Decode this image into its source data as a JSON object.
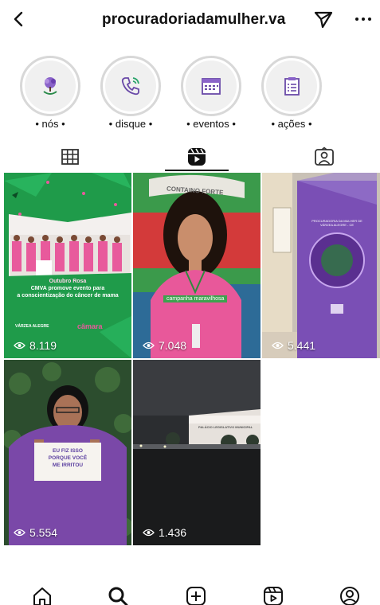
{
  "header": {
    "username": "procuradoriadamulher.va"
  },
  "highlights": [
    {
      "label": "• nós •",
      "icon": "tree-hands-icon"
    },
    {
      "label": "• disque •",
      "icon": "phone-icon"
    },
    {
      "label": "• eventos •",
      "icon": "calendar-icon"
    },
    {
      "label": "• ações •",
      "icon": "clipboard-icon"
    }
  ],
  "tabs": [
    {
      "name": "grid",
      "icon": "grid-icon"
    },
    {
      "name": "reels",
      "icon": "reels-icon",
      "active": true
    },
    {
      "name": "tagged",
      "icon": "tagged-person-icon"
    }
  ],
  "reels": [
    {
      "views": "8.119",
      "caption_title": "Outubro Rosa",
      "caption_line1": "CMVA promove evento para",
      "caption_line2": "a conscientização do câncer de mama",
      "logo_left": "VÁRZEA ALEGRE",
      "logo_right": "câmara"
    },
    {
      "views": "7.048",
      "banner": "CONTAINO FORTE",
      "caption": "campanha maravilhosa"
    },
    {
      "views": "5.441",
      "door_text": "PROCURADORIA DA MULHER DE VÁRZEA ALEGRE - CE"
    },
    {
      "views": "5.554",
      "sign_line1": "EU FIZ ISSO",
      "sign_line2": "PORQUE VOCÊ",
      "sign_line3": "ME IRRITOU"
    },
    {
      "views": "1.436",
      "building_text": "PALÁCIO LEGISLATIVO MUNICIPAL"
    }
  ],
  "colors": {
    "accent_green": "#1f9b4a",
    "pink": "#e8589a",
    "purple": "#7a4fb5"
  }
}
